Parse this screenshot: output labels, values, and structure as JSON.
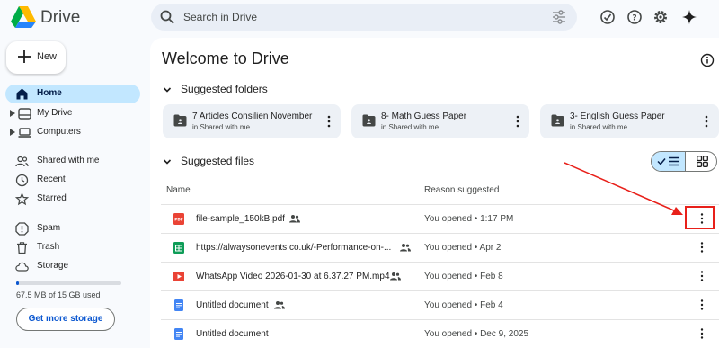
{
  "app": {
    "title": "Drive"
  },
  "search": {
    "placeholder": "Search in Drive"
  },
  "sidebar": {
    "new_label": "New",
    "items": [
      {
        "label": "Home",
        "icon": "home-icon",
        "active": true
      },
      {
        "label": "My Drive",
        "icon": "my-drive-icon"
      },
      {
        "label": "Computers",
        "icon": "computer-icon"
      },
      {
        "label": "Shared with me",
        "icon": "people-icon"
      },
      {
        "label": "Recent",
        "icon": "clock-icon"
      },
      {
        "label": "Starred",
        "icon": "star-icon"
      },
      {
        "label": "Spam",
        "icon": "spam-icon"
      },
      {
        "label": "Trash",
        "icon": "trash-icon"
      },
      {
        "label": "Storage",
        "icon": "cloud-icon"
      }
    ],
    "storage": {
      "text": "67.5 MB of 15 GB used",
      "fraction_used": 0.0045,
      "button_label": "Get more storage"
    }
  },
  "main": {
    "title": "Welcome to Drive",
    "suggested_folders": {
      "label": "Suggested folders",
      "items": [
        {
          "name": "7 Articles Consilien November",
          "location": "in Shared with me"
        },
        {
          "name": "8- Math Guess Paper",
          "location": "in Shared with me"
        },
        {
          "name": "3- English Guess Paper",
          "location": "in Shared with me"
        }
      ]
    },
    "suggested_files": {
      "label": "Suggested files",
      "columns": {
        "name": "Name",
        "reason": "Reason suggested"
      },
      "rows": [
        {
          "name": "file-sample_150kB.pdf",
          "type": "pdf",
          "reason": "You opened • 1:17 PM"
        },
        {
          "name": "https://alwaysonevents.co.uk/-Performance-on-...",
          "type": "sheet",
          "reason": "You opened • Apr 2"
        },
        {
          "name": "WhatsApp Video 2026-01-30 at 6.37.27 PM.mp4",
          "type": "video",
          "reason": "You opened • Feb 8"
        },
        {
          "name": "Untitled document",
          "type": "doc",
          "reason": "You opened • Feb 4"
        },
        {
          "name": "Untitled document",
          "type": "doc",
          "reason": "You opened • Dec 9, 2025"
        }
      ]
    }
  },
  "colors": {
    "accent": "#0b57d0",
    "active_bg": "#c2e7ff",
    "annotation": "#e8201a"
  }
}
